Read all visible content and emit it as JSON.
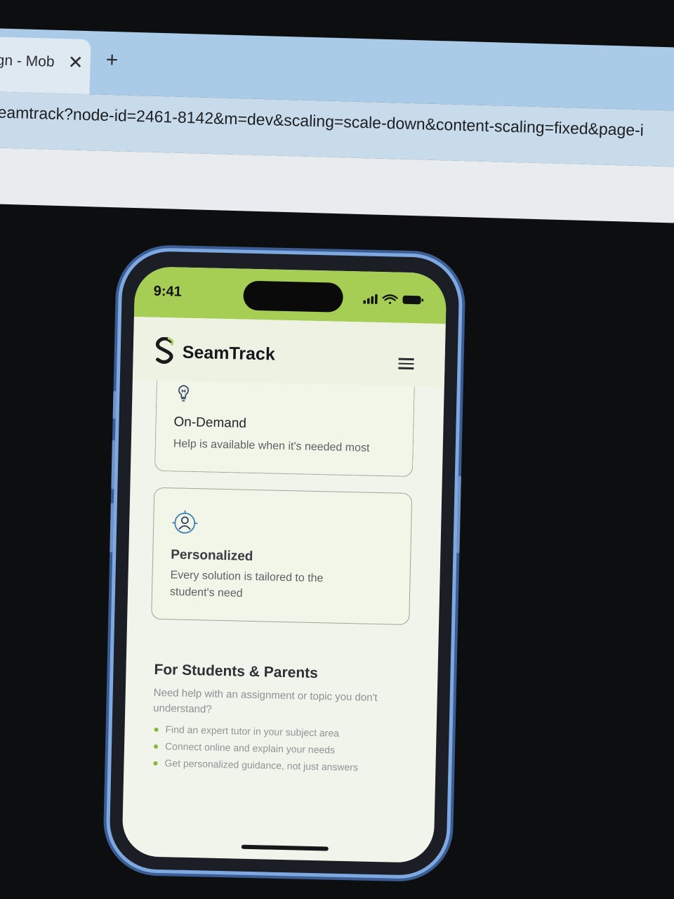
{
  "browser": {
    "tab_title": "gn - Mob",
    "tab_close": "✕",
    "new_tab": "+",
    "url": "eamtrack?node-id=2461-8142&m=dev&scaling=scale-down&content-scaling=fixed&page-i"
  },
  "phone": {
    "status": {
      "time": "9:41"
    },
    "app": {
      "brand": "SeamTrack",
      "brand_color": "#1a1a1a",
      "accent_color": "#a6cd54",
      "cards": [
        {
          "icon": "lightbulb-icon",
          "title": "On-Demand",
          "description": "Help is available when it's needed most"
        },
        {
          "icon": "person-target-icon",
          "title": "Personalized",
          "description": "Every solution is tailored to the student's need"
        }
      ],
      "section": {
        "title": "For Students & Parents",
        "description": "Need help with an assignment or topic you don't understand?",
        "bullets": [
          "Find an expert tutor in your subject area",
          "Connect online and explain your needs",
          "Get personalized guidance, not just answers"
        ]
      }
    }
  }
}
